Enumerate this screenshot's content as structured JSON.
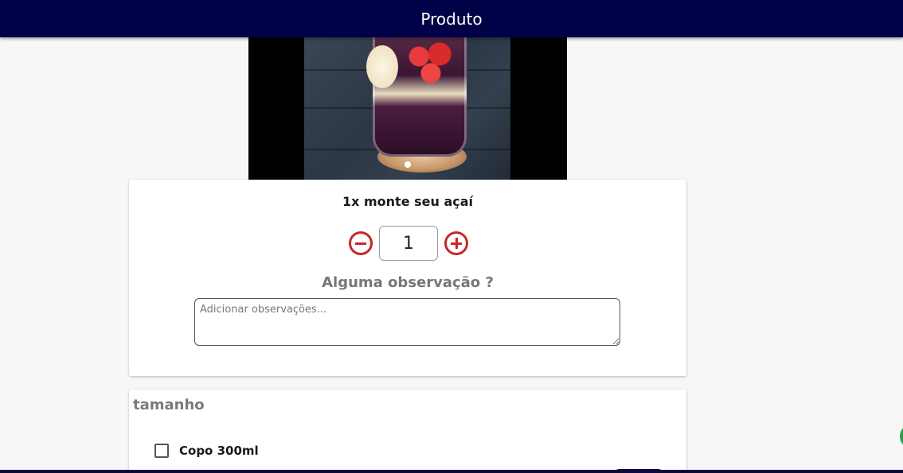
{
  "header": {
    "title": "Produto"
  },
  "product": {
    "name": "1x monte seu açaí",
    "quantity": "1",
    "carousel": {
      "slides": 1,
      "active_slide": 1
    }
  },
  "observation": {
    "label": "Alguma observação ?",
    "placeholder": "Adicionar observações...",
    "value": ""
  },
  "options_section": {
    "title": "tamanho",
    "items": [
      {
        "label": "Copo 300ml",
        "checked": false
      }
    ]
  },
  "colors": {
    "header_bg": "#010148",
    "stepper_accent": "#c62828",
    "section_title": "#7a7a7a",
    "fab": "#25a244"
  },
  "icons": {
    "minus": "minus-circle-icon",
    "plus": "plus-circle-icon",
    "whatsapp": "whatsapp-icon"
  }
}
